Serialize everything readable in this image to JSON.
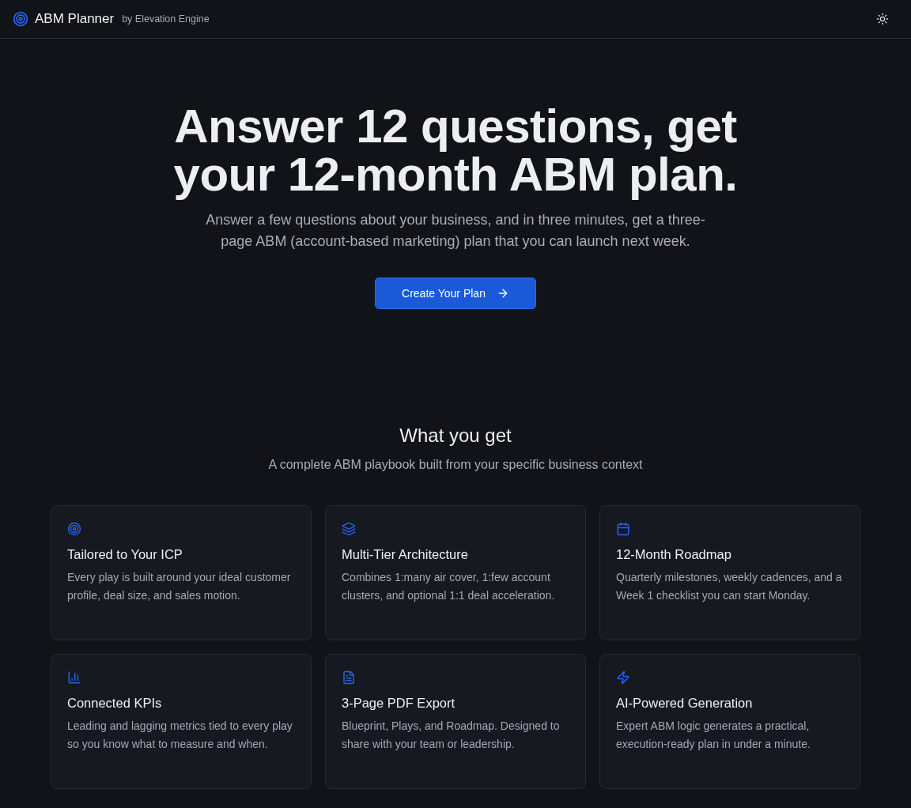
{
  "header": {
    "brand": "ABM Planner",
    "byline": "by Elevation Engine",
    "theme_toggle": {
      "kind": "sun"
    }
  },
  "hero": {
    "title_lines": [
      "Answer 12 questions, get",
      "your 12-month ABM plan."
    ],
    "subtitle_lines": [
      "Answer a few questions about your business, and in three minutes, get a three-",
      "page ABM (account-based marketing) plan that you can launch next week."
    ],
    "cta": "Create Your Plan"
  },
  "features": {
    "title": "What you get",
    "subtitle": "A complete ABM playbook built from your specific business context",
    "cards": [
      {
        "kind": "target",
        "title": "Tailored to Your ICP",
        "text": "Every play is built around your ideal customer profile, deal size, and sales motion."
      },
      {
        "kind": "layers",
        "title": "Multi-Tier Architecture",
        "text": "Combines 1:many air cover, 1:few account clusters, and optional 1:1 deal acceleration."
      },
      {
        "kind": "calendar",
        "title": "12-Month Roadmap",
        "text": "Quarterly milestones, weekly cadences, and a Week 1 checklist you can start Monday."
      },
      {
        "kind": "chart",
        "title": "Connected KPIs",
        "text": "Leading and lagging metrics tied to every play so you know what to measure and when."
      },
      {
        "kind": "file",
        "title": "3-Page PDF Export",
        "text": "Blueprint, Plays, and Roadmap. Designed to share with your team or leadership."
      },
      {
        "kind": "bolt",
        "title": "AI-Powered Generation",
        "text": "Expert ABM logic generates a practical, execution-ready plan in under a minute."
      }
    ]
  }
}
